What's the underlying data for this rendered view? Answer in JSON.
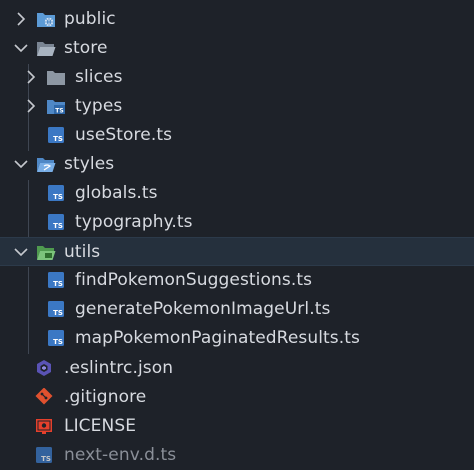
{
  "explorer": {
    "items": [
      {
        "name": "public",
        "kind": "folder",
        "state": "collapsed",
        "icon": "folder-public-icon"
      },
      {
        "name": "store",
        "kind": "folder",
        "state": "expanded",
        "icon": "folder-open-icon"
      },
      {
        "name": "slices",
        "kind": "folder",
        "state": "collapsed",
        "icon": "folder-icon"
      },
      {
        "name": "types",
        "kind": "folder",
        "state": "collapsed",
        "icon": "folder-types-icon"
      },
      {
        "name": "useStore.ts",
        "kind": "file",
        "icon": "typescript-file-icon"
      },
      {
        "name": "styles",
        "kind": "folder",
        "state": "expanded",
        "icon": "folder-styles-icon"
      },
      {
        "name": "globals.ts",
        "kind": "file",
        "icon": "typescript-file-icon"
      },
      {
        "name": "typography.ts",
        "kind": "file",
        "icon": "typescript-file-icon"
      },
      {
        "name": "utils",
        "kind": "folder",
        "state": "expanded",
        "selected": true,
        "icon": "folder-utils-icon"
      },
      {
        "name": "findPokemonSuggestions.ts",
        "kind": "file",
        "icon": "typescript-file-icon"
      },
      {
        "name": "generatePokemonImageUrl.ts",
        "kind": "file",
        "icon": "typescript-file-icon"
      },
      {
        "name": "mapPokemonPaginatedResults.ts",
        "kind": "file",
        "icon": "typescript-file-icon"
      },
      {
        "name": ".eslintrc.json",
        "kind": "file",
        "icon": "eslint-icon"
      },
      {
        "name": ".gitignore",
        "kind": "file",
        "icon": "git-icon"
      },
      {
        "name": "LICENSE",
        "kind": "file",
        "icon": "license-icon"
      },
      {
        "name": "next-env.d.ts",
        "kind": "file",
        "state": "dimmed",
        "icon": "typescript-file-icon"
      }
    ],
    "colors": {
      "background": "#1e2229",
      "selected_row": "#25303d",
      "text": "#d7dae0",
      "text_dimmed": "#8a8f98",
      "folder_blue": "#5c9bd6",
      "folder_green": "#6bb36b",
      "ts_blue": "#3b78c4",
      "eslint_purple": "#5a53b5",
      "git_orange": "#e0512f",
      "license_red": "#e5402c"
    }
  }
}
